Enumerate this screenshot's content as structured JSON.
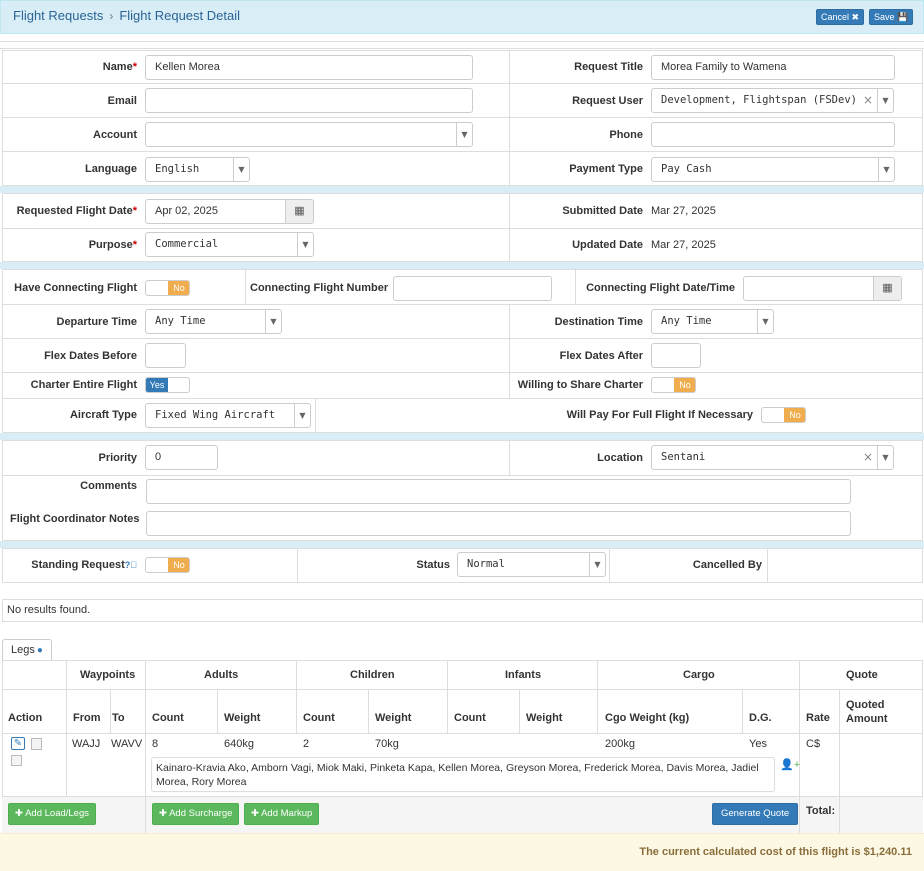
{
  "breadcrumb": {
    "parent": "Flight Requests",
    "current": "Flight Request Detail"
  },
  "toolbar": {
    "cancel": "Cancel ✖",
    "save": "Save 💾"
  },
  "section1": {
    "name_label": "Name",
    "name_value": "Kellen Morea",
    "request_title_label": "Request Title",
    "request_title_value": "Morea Family to Wamena",
    "email_label": "Email",
    "email_value": "",
    "request_user_label": "Request User",
    "request_user_value": "Development, Flightspan (FSDev)",
    "account_label": "Account",
    "account_value": "",
    "phone_label": "Phone",
    "phone_value": "",
    "language_label": "Language",
    "language_value": "English",
    "payment_type_label": "Payment Type",
    "payment_type_value": "Pay Cash"
  },
  "section2": {
    "requested_date_label": "Requested Flight Date",
    "requested_date_value": "Apr 02, 2025",
    "submitted_label": "Submitted Date",
    "submitted_value": "Mar 27, 2025",
    "purpose_label": "Purpose",
    "purpose_value": "Commercial",
    "updated_label": "Updated Date",
    "updated_value": "Mar 27, 2025"
  },
  "section3": {
    "connecting_label": "Have Connecting Flight",
    "connecting_value": "No",
    "conn_number_label": "Connecting Flight Number",
    "conn_number_value": "",
    "conn_datetime_label": "Connecting Flight Date/Time",
    "conn_datetime_value": "",
    "departure_label": "Departure Time",
    "departure_value": "Any Time",
    "destination_label": "Destination Time",
    "destination_value": "Any Time",
    "flex_before_label": "Flex Dates Before",
    "flex_before_value": "",
    "flex_after_label": "Flex Dates After",
    "flex_after_value": "",
    "charter_label": "Charter Entire Flight",
    "charter_value": "Yes",
    "share_label": "Willing to Share Charter",
    "share_value": "No",
    "aircraft_label": "Aircraft Type",
    "aircraft_value": "Fixed Wing Aircraft",
    "pay_full_label": "Will Pay For Full Flight If Necessary",
    "pay_full_value": "No"
  },
  "section4": {
    "priority_label": "Priority",
    "priority_value": "0",
    "location_label": "Location",
    "location_value": "Sentani",
    "comments_label": "Comments",
    "comments_value": "",
    "notes_label": "Flight Coordinator Notes",
    "notes_value": ""
  },
  "section5": {
    "standing_label": "Standing Request",
    "standing_value": "No",
    "status_label": "Status",
    "status_value": "Normal",
    "cancelled_label": "Cancelled By",
    "cancelled_value": ""
  },
  "no_results": "No results found.",
  "legs": {
    "tab_label": "Legs",
    "groups": {
      "waypoints": "Waypoints",
      "adults": "Adults",
      "children": "Children",
      "infants": "Infants",
      "cargo": "Cargo",
      "quote": "Quote"
    },
    "cols": {
      "action": "Action",
      "from": "From",
      "to": "To",
      "count": "Count",
      "weight": "Weight",
      "cgo_weight": "Cgo Weight (kg)",
      "dg": "D.G.",
      "rate": "Rate",
      "quoted": "Quoted Amount"
    },
    "row": {
      "from": "WAJJ",
      "to": "WAVV",
      "adult_count": "8",
      "adult_weight": "640kg",
      "child_count": "2",
      "child_weight": "70kg",
      "infant_count": "",
      "infant_weight": "",
      "cargo_weight": "200kg",
      "dg": "Yes",
      "rate": "C$",
      "quoted": ""
    },
    "passengers": "Kainaro-Kravia Ako, Amborn Vagi, Miok Maki, Pinketa Kapa, Kellen Morea, Greyson Morea, Frederick Morea, Davis Morea, Jadiel Morea, Rory Morea",
    "add_load": "Add Load/Legs",
    "add_surcharge": "Add Surcharge",
    "add_markup": "Add Markup",
    "generate_quote": "Generate Quote",
    "total_label": "Total:"
  },
  "footer_text": "The current calculated cost of this flight is $1,240.11"
}
